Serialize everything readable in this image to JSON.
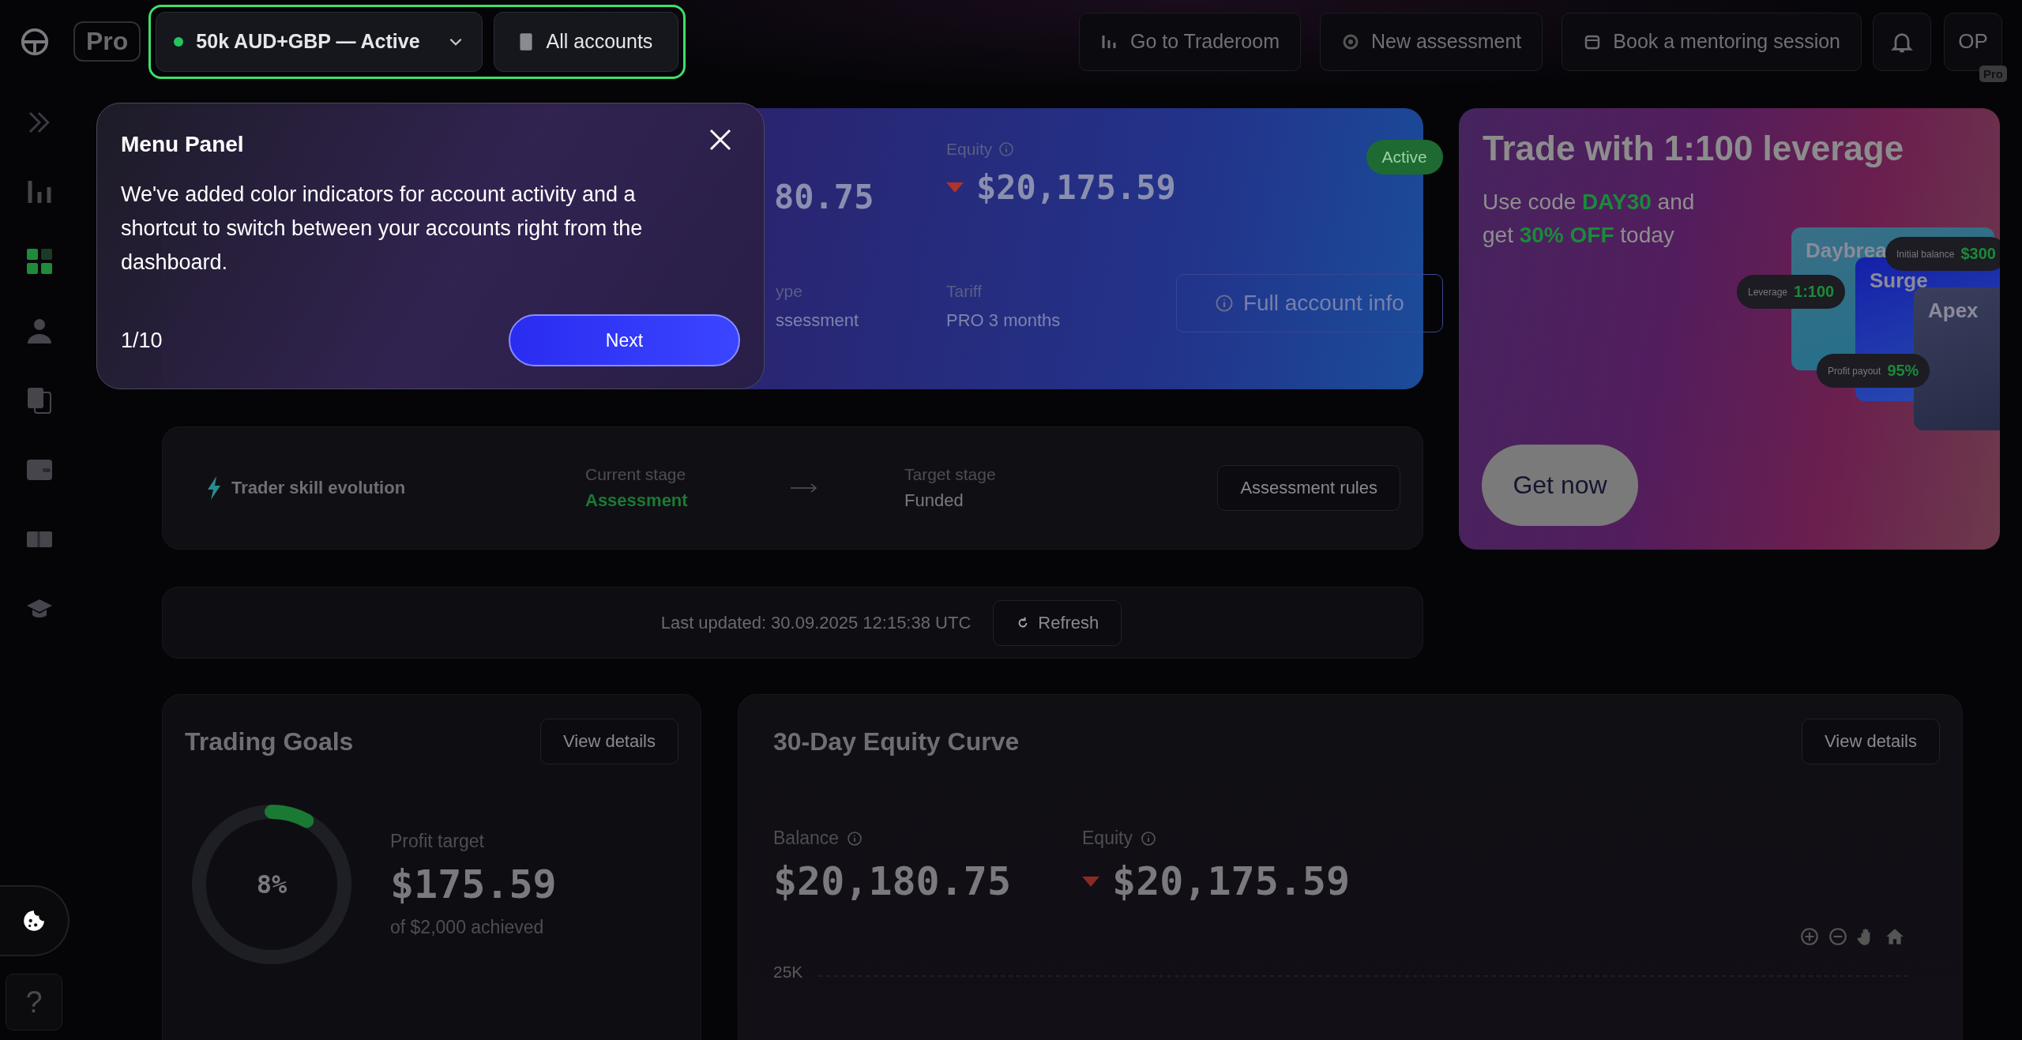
{
  "topbar": {
    "logo_badge": "Pro",
    "account_selector": {
      "label": "50k AUD+GBP — Active",
      "color": "#22c55e"
    },
    "all_accounts": "All accounts",
    "actions": [
      {
        "label": "Go to Traderoom"
      },
      {
        "label": "New assessment"
      },
      {
        "label": "Book a mentoring session"
      }
    ],
    "user": {
      "initials": "OP",
      "badge": "Pro"
    }
  },
  "sidebar": {
    "items": [
      {
        "selected": false
      },
      {
        "selected": true
      },
      {
        "selected": false
      },
      {
        "selected": false
      },
      {
        "selected": false
      },
      {
        "selected": false
      },
      {
        "selected": false
      }
    ],
    "help": "?"
  },
  "tour": {
    "title": "Menu Panel",
    "text": "We've added color indicators for account activity and a shortcut to switch between your accounts right from the dashboard.",
    "step": "1/10",
    "next": "Next"
  },
  "account_card": {
    "balance_fragment": "80.75",
    "equity_label": "Equity",
    "equity": "$20,175.59",
    "equity_falling": true,
    "status": "Active",
    "type_label_fragment": "ype",
    "type_fragment": "ssessment",
    "tariff_label": "Tariff",
    "tariff": "PRO 3 months",
    "info_button": "Full account info"
  },
  "promo": {
    "title": "Trade with 1:100 leverage",
    "text": "Use code **DAY30** and get **30% OFF** today",
    "button": "Get now",
    "plans": [
      "Daybrea",
      "Surge",
      "Apex"
    ],
    "pills": [
      {
        "label": "Leverage",
        "value": "1:100"
      },
      {
        "label": "Initial balance",
        "value": "$300"
      },
      {
        "label": "Profit payout",
        "value": "95%"
      }
    ]
  },
  "skill": {
    "title": "Trader skill evolution",
    "current_label": "Current stage",
    "current": "Assessment",
    "target_label": "Target stage",
    "target": "Funded",
    "rules_button": "Assessment rules"
  },
  "update_bar": {
    "text": "Last updated: 30.09.2025 12:15:38 UTC",
    "button": "Refresh"
  },
  "goals": {
    "title": "Trading Goals",
    "button": "View details",
    "level": 0.08,
    "percent": "8%",
    "label": "Profit target",
    "value": "$175.59",
    "caption": "of $2,000 achieved"
  },
  "equity_curve": {
    "title": "30-Day Equity Curve",
    "button": "View details",
    "balance_label": "Balance",
    "balance": "$20,180.75",
    "equity_label": "Equity",
    "equity": "$20,175.59",
    "equity_falling": true,
    "y_label": "25K"
  }
}
